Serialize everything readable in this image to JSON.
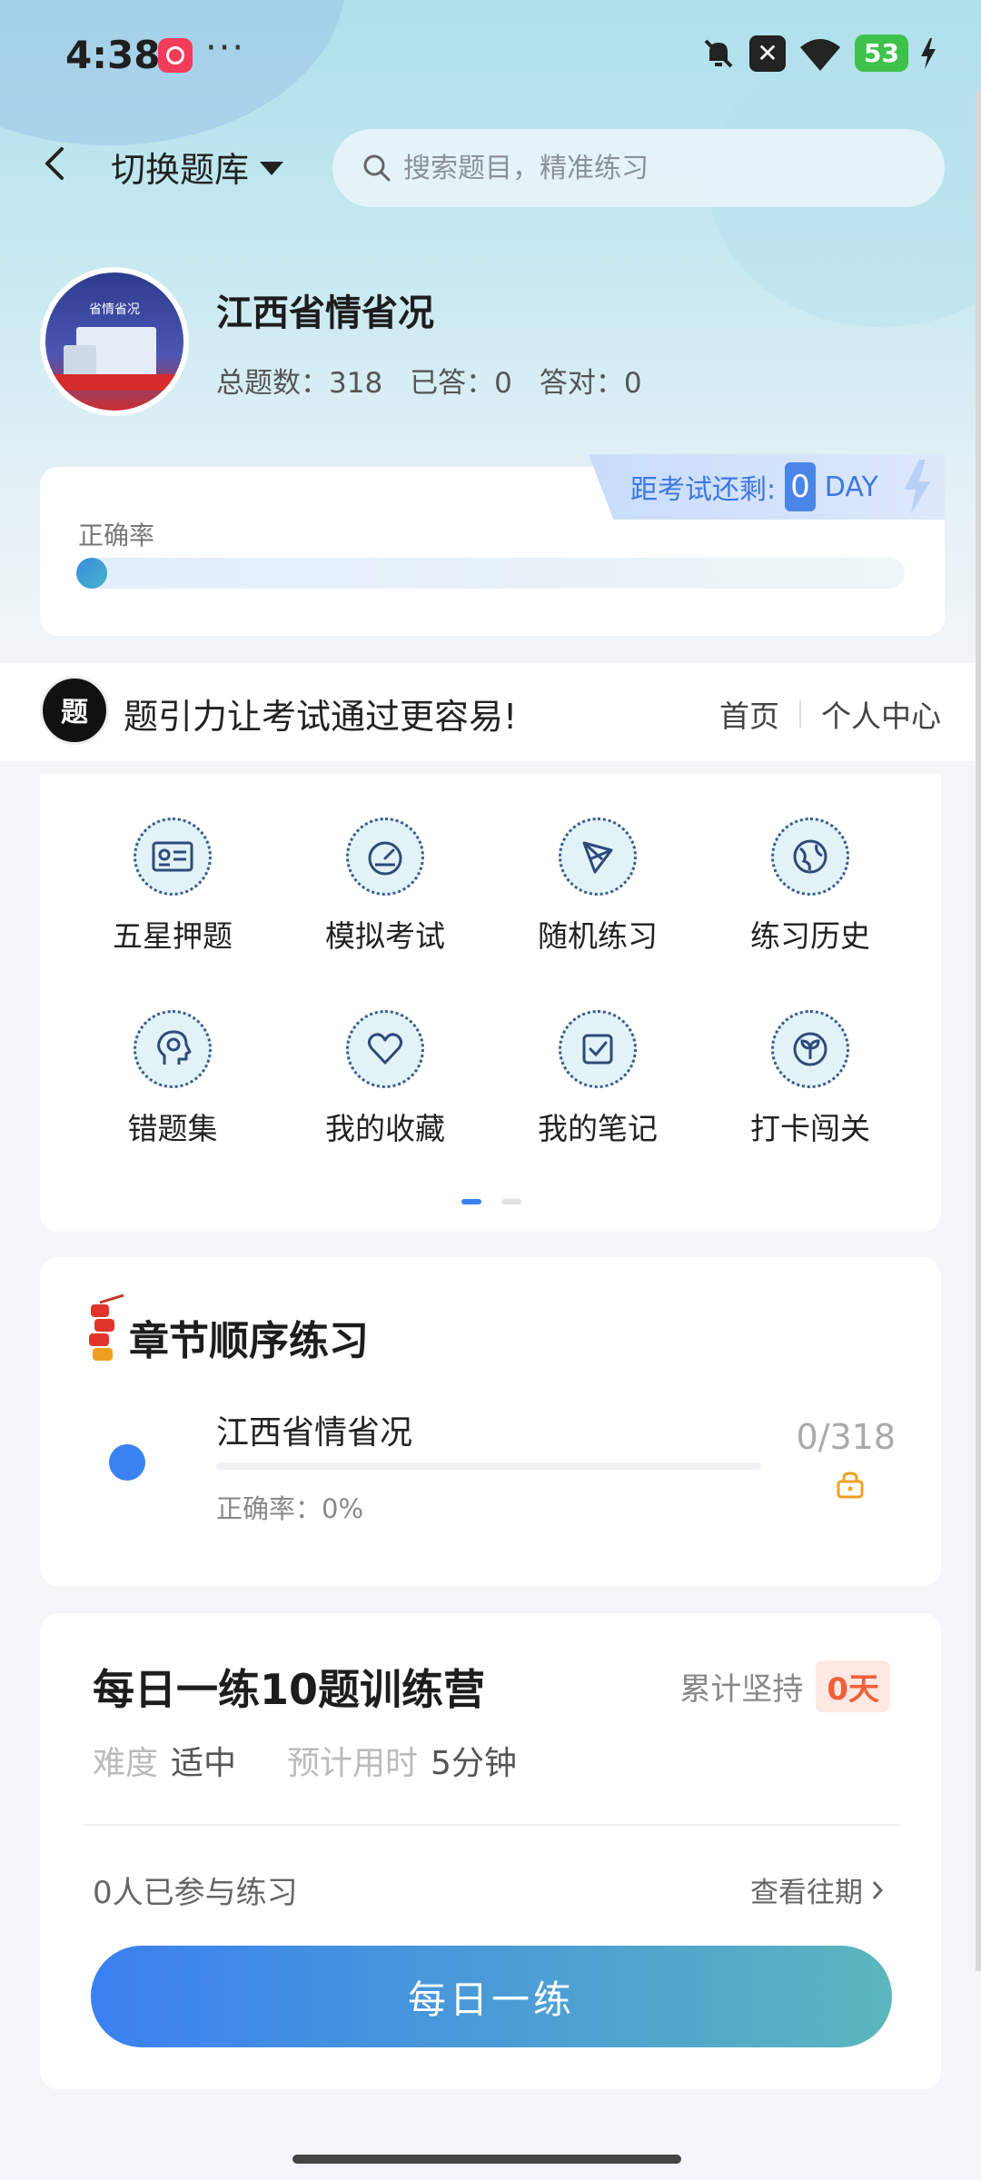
{
  "status_bar": {
    "time": "4:38",
    "dots": "···",
    "battery": "53"
  },
  "header": {
    "switch_label": "切换题库",
    "search_placeholder": "搜索题目，精准练习"
  },
  "profile": {
    "avatar_caption": "省情省况",
    "title": "江西省情省况",
    "total_label": "总题数：318",
    "answered_label": "已答：0",
    "correct_label": "答对：0"
  },
  "accuracy": {
    "label": "正确率",
    "value_percent": 0,
    "countdown_label": "距考试还剩:",
    "countdown_value": "0",
    "countdown_unit": "DAY"
  },
  "promo": {
    "logo_text": "题",
    "text": "题引力让考试通过更容易!",
    "nav": [
      "首页",
      "个人中心"
    ]
  },
  "menu": {
    "items": [
      {
        "label": "五星押题",
        "icon": "id-card-icon"
      },
      {
        "label": "模拟考试",
        "icon": "speedometer-icon"
      },
      {
        "label": "随机练习",
        "icon": "shuffle-icon"
      },
      {
        "label": "练习历史",
        "icon": "globe-icon"
      },
      {
        "label": "错题集",
        "icon": "head-icon"
      },
      {
        "label": "我的收藏",
        "icon": "heart-icon"
      },
      {
        "label": "我的笔记",
        "icon": "note-check-icon"
      },
      {
        "label": "打卡闯关",
        "icon": "sprout-icon"
      }
    ],
    "pages": 2,
    "active_page": 0
  },
  "chapter": {
    "title": "章节顺序练习",
    "item_name": "江西省情省况",
    "accuracy_label": "正确率：0%",
    "count": "0/318"
  },
  "daily": {
    "title": "每日一练10题训练营",
    "streak_label": "累计坚持",
    "streak_value": "0天",
    "difficulty_key": "难度",
    "difficulty_value": "适中",
    "time_key": "预计用时",
    "time_value": "5分钟",
    "participants": "0人已参与练习",
    "history_link": "查看往期",
    "button": "每日一练"
  },
  "colors": {
    "accent_blue": "#3a82f0",
    "accent_teal": "#5bb6bd",
    "streak_orange": "#f0603a",
    "lock_orange": "#f0a020"
  }
}
